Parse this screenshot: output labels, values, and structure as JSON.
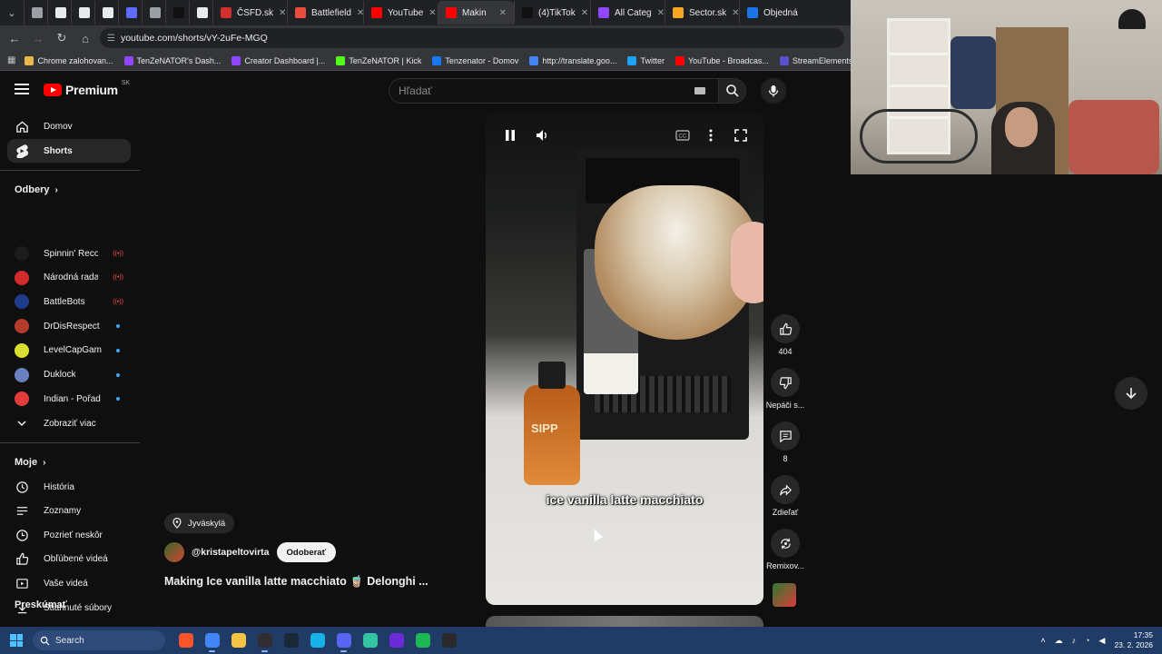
{
  "browser": {
    "tabs": [
      {
        "label": "",
        "color": "#9aa0a6"
      },
      {
        "label": "",
        "color": "#e8eaed"
      },
      {
        "label": "",
        "color": "#e8eaed"
      },
      {
        "label": "",
        "color": "#e8eaed"
      },
      {
        "label": "",
        "color": "#5f6bff"
      },
      {
        "label": "",
        "color": "#9aa0a6"
      },
      {
        "label": "B",
        "color": "#111111"
      },
      {
        "label": "",
        "color": "#e8eaed"
      },
      {
        "label": "ČSFD.sk",
        "color": "#d32f2f"
      },
      {
        "label": "Battlefield",
        "color": "#e74c3c"
      },
      {
        "label": "YouTube",
        "color": "#ff0000"
      },
      {
        "label": "Makin",
        "color": "#ff0000",
        "active": true
      },
      {
        "label": "(4)TikTok",
        "color": "#111111"
      },
      {
        "label": "All Categ",
        "color": "#9146ff"
      },
      {
        "label": "Sector.sk",
        "color": "#f5a623"
      },
      {
        "label": "Objedná",
        "color": "#1a73e8"
      }
    ],
    "url": "youtube.com/shorts/vY-2uFe-MGQ",
    "bookmarks": [
      {
        "label": "Chrome zalohovan...",
        "color": "#e8b84a"
      },
      {
        "label": "TenZeNATOR's Dash...",
        "color": "#9146ff"
      },
      {
        "label": "Creator Dashboard |...",
        "color": "#9146ff"
      },
      {
        "label": "TenZeNATOR | Kick",
        "color": "#53fc18"
      },
      {
        "label": "Tenzenator - Domov",
        "color": "#1877f2"
      },
      {
        "label": "http://translate.goo...",
        "color": "#4285f4"
      },
      {
        "label": "Twitter",
        "color": "#1da1f2"
      },
      {
        "label": "YouTube - Broadcas...",
        "color": "#ff0000"
      },
      {
        "label": "StreamElements - C...",
        "color": "#5a4fcf"
      },
      {
        "label": "TESTY -",
        "color": "#c9b27a"
      }
    ]
  },
  "youtube": {
    "logo_text": "Premium",
    "logo_region": "SK",
    "search_placeholder": "Hľadať",
    "sidebar": {
      "main": [
        {
          "label": "Domov",
          "icon": "home-icon"
        },
        {
          "label": "Shorts",
          "icon": "shorts-icon",
          "active": true
        }
      ],
      "subscriptions_title": "Odbery",
      "subscriptions": [
        {
          "label": "Spinnin' Records",
          "status": "live",
          "color": "#1c1c1c"
        },
        {
          "label": "Národná rada Sl...",
          "status": "live",
          "color": "#d12b2b"
        },
        {
          "label": "BattleBots",
          "status": "live",
          "color": "#1e3c8c"
        },
        {
          "label": "DrDisRespect",
          "status": "new",
          "color": "#b33b2e"
        },
        {
          "label": "LevelCapGaming",
          "status": "new",
          "color": "#d7e02f"
        },
        {
          "label": "Duklock",
          "status": "new",
          "color": "#6a7fbf"
        },
        {
          "label": "Indian - Pořad o ...",
          "status": "new",
          "color": "#e23b3b"
        }
      ],
      "show_more": "Zobraziť viac",
      "you_title": "Moje",
      "you": [
        {
          "label": "História",
          "icon": "history-icon"
        },
        {
          "label": "Zoznamy",
          "icon": "playlists-icon"
        },
        {
          "label": "Pozrieť neskôr",
          "icon": "watch-later-icon"
        },
        {
          "label": "Obľúbené videá",
          "icon": "liked-videos-icon"
        },
        {
          "label": "Vaše videá",
          "icon": "your-videos-icon"
        },
        {
          "label": "Stiahnuté súbory",
          "icon": "downloads-icon"
        }
      ],
      "explore_title": "Preskúmať"
    },
    "short": {
      "location": "Jyväskylä",
      "channel": "@kristapeltovirta",
      "subscribe_label": "Odoberať",
      "title": "Making Ice vanilla latte macchiato 🧋 Delonghi ...",
      "caption": "ice vanilla latte macchiato",
      "bottle_label": "SIPP"
    },
    "actions": {
      "like_count": "404",
      "dislike_label": "Nepáči s...",
      "comment_count": "8",
      "share_label": "Zdieľať",
      "remix_label": "Remixov..."
    }
  },
  "taskbar": {
    "search_label": "Search",
    "apps": [
      {
        "name": "brave-app-icon",
        "color": "#fb542b"
      },
      {
        "name": "chrome-app-icon",
        "color": "#4285f4",
        "running": true
      },
      {
        "name": "file-explorer-icon",
        "color": "#f6c343"
      },
      {
        "name": "obs-app-icon",
        "color": "#302e31",
        "running": true
      },
      {
        "name": "steam-app-icon",
        "color": "#1b2838"
      },
      {
        "name": "kodi-app-icon",
        "color": "#17b2e7"
      },
      {
        "name": "discord-app-icon",
        "color": "#5865f2",
        "running": true
      },
      {
        "name": "streamlabs-app-icon",
        "color": "#31c3a2"
      },
      {
        "name": "next-app-icon",
        "color": "#6b2bd9"
      },
      {
        "name": "spotify-app-icon",
        "color": "#1db954"
      },
      {
        "name": "epic-games-icon",
        "color": "#2a2a2a"
      }
    ],
    "time": "17:35",
    "date": "23. 2. 2026"
  }
}
